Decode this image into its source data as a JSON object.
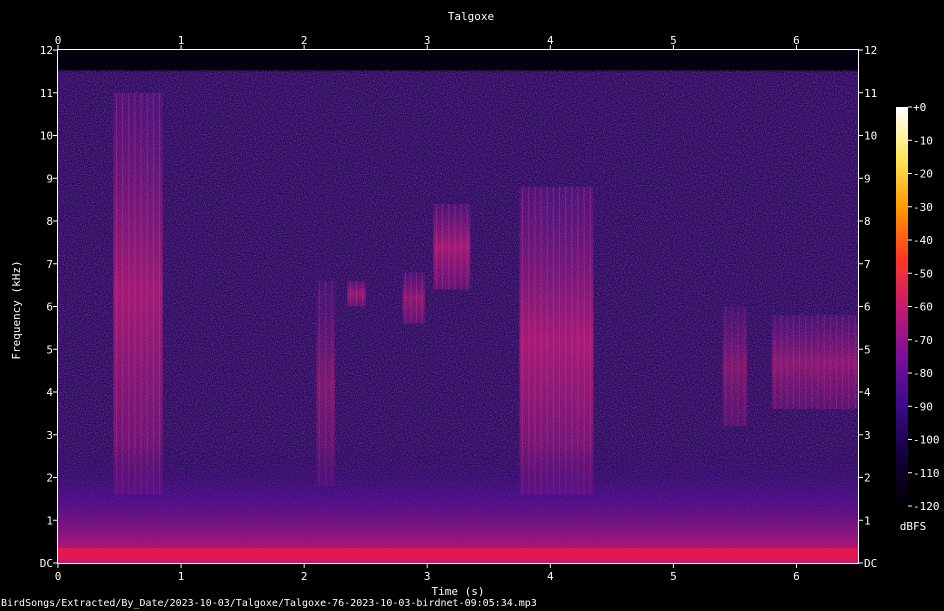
{
  "chart_data": {
    "type": "heatmap",
    "title": "Talgoxe",
    "xlabel": "Time (s)",
    "ylabel": "Frequency (kHz)",
    "xlim": [
      0,
      6.5
    ],
    "ylim": [
      0,
      12
    ],
    "x_ticks": [
      "0",
      "1",
      "2",
      "3",
      "4",
      "5",
      "6"
    ],
    "y_ticks": [
      "DC",
      "1",
      "2",
      "3",
      "4",
      "5",
      "6",
      "7",
      "8",
      "9",
      "10",
      "11",
      "12"
    ],
    "colorbar": {
      "label": "dBFS",
      "range": [
        -120,
        0
      ],
      "ticks": [
        "+0",
        "-10",
        "-20",
        "-30",
        "-40",
        "-50",
        "-60",
        "-70",
        "-80",
        "-90",
        "-100",
        "-110",
        "-120"
      ],
      "colors": [
        "#000000",
        "#14003c",
        "#3a0a88",
        "#7a0f9c",
        "#c81a6e",
        "#ff3a20",
        "#ff9a00",
        "#ffe95a",
        "#ffffff"
      ]
    },
    "noise_floor_khz": 11.5,
    "calls": [
      {
        "t_start": 0.45,
        "t_end": 0.85,
        "f_low": 1.6,
        "f_high": 11.0,
        "level_dbfs": -72
      },
      {
        "t_start": 2.1,
        "t_end": 2.25,
        "f_low": 1.8,
        "f_high": 6.6,
        "level_dbfs": -85
      },
      {
        "t_start": 2.35,
        "t_end": 2.5,
        "f_low": 6.0,
        "f_high": 6.6,
        "level_dbfs": -75
      },
      {
        "t_start": 2.8,
        "t_end": 2.98,
        "f_low": 5.6,
        "f_high": 6.8,
        "level_dbfs": -78
      },
      {
        "t_start": 3.05,
        "t_end": 3.35,
        "f_low": 6.4,
        "f_high": 8.4,
        "level_dbfs": -72
      },
      {
        "t_start": 3.75,
        "t_end": 4.35,
        "f_low": 1.6,
        "f_high": 8.8,
        "level_dbfs": -70
      },
      {
        "t_start": 5.4,
        "t_end": 5.6,
        "f_low": 3.2,
        "f_high": 6.0,
        "level_dbfs": -85
      },
      {
        "t_start": 5.8,
        "t_end": 6.5,
        "f_low": 3.6,
        "f_high": 5.8,
        "level_dbfs": -80
      }
    ]
  },
  "footer": {
    "file_path": "BirdSongs/Extracted/By_Date/2023-10-03/Talgoxe/Talgoxe-76-2023-10-03-birdnet-09:05:34.mp3"
  }
}
